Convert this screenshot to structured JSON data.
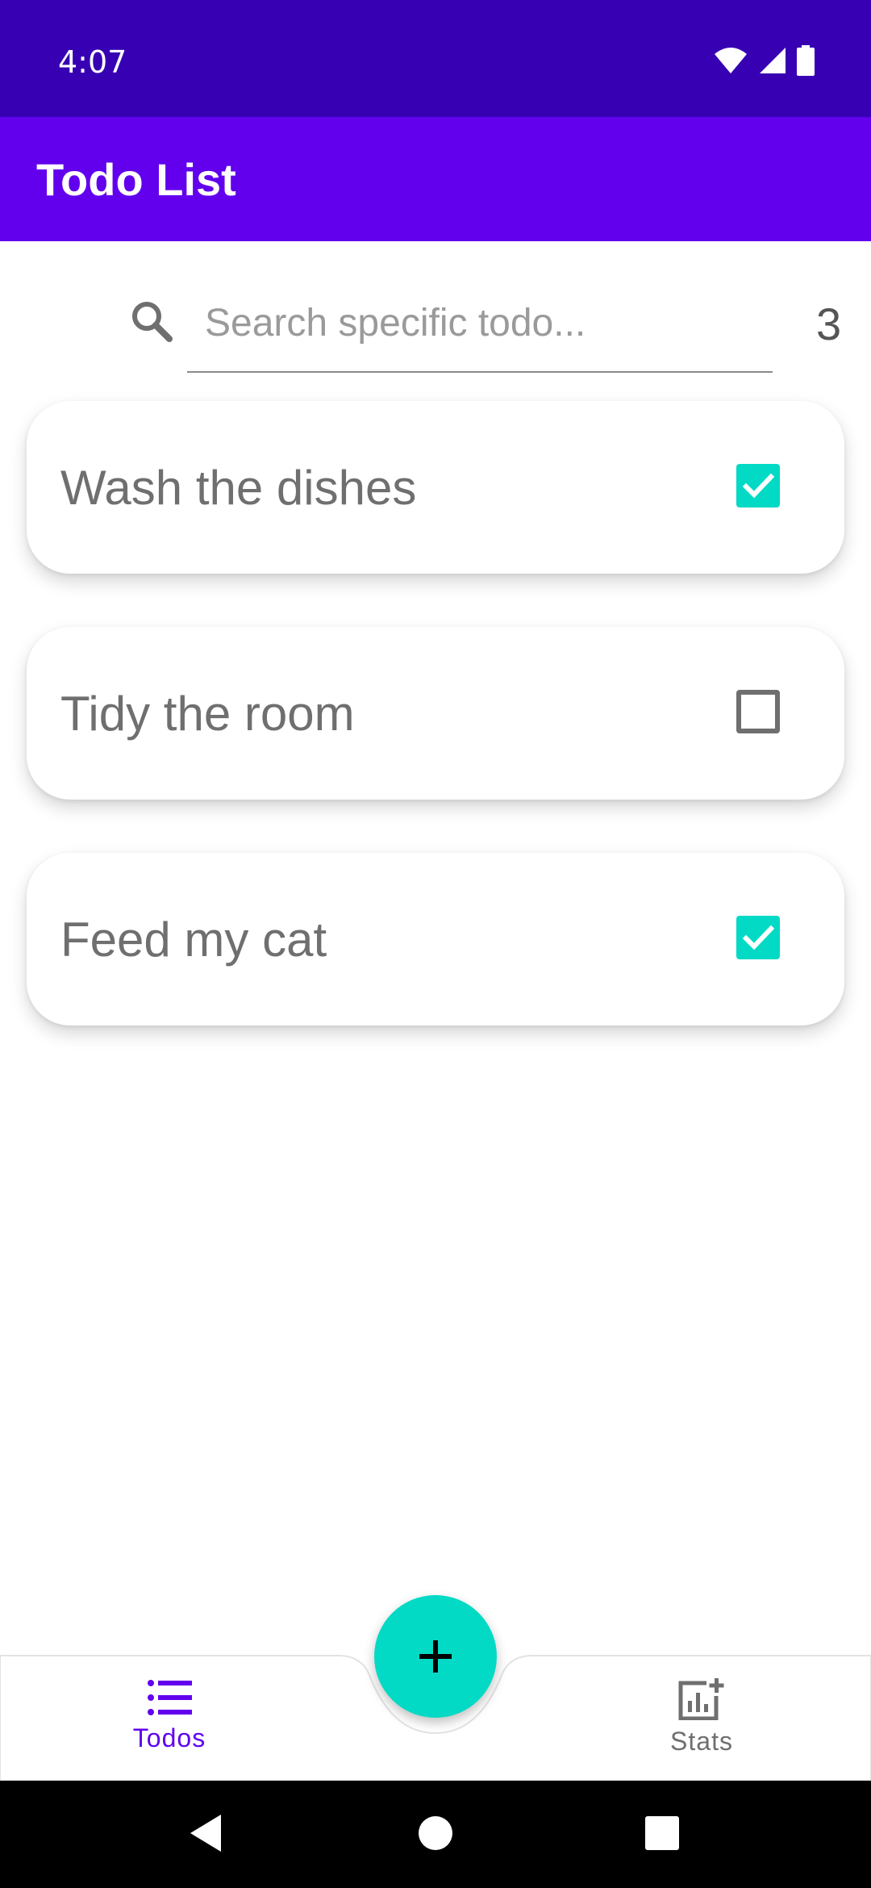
{
  "status_bar": {
    "time": "4:07",
    "icons": [
      "wifi-icon",
      "signal-icon",
      "battery-icon"
    ],
    "background": "#3700b3"
  },
  "app_bar": {
    "title": "Todo List",
    "background": "#6200ee"
  },
  "search": {
    "placeholder": "Search specific todo...",
    "value": "",
    "icon": "search-icon",
    "count": "3"
  },
  "todos": [
    {
      "text": "Wash the dishes",
      "checked": true
    },
    {
      "text": "Tidy the room",
      "checked": false
    },
    {
      "text": "Feed my cat",
      "checked": true
    }
  ],
  "bottom_nav": {
    "items": [
      {
        "label": "Todos",
        "icon": "list-icon",
        "active": true
      },
      {
        "label": "Stats",
        "icon": "stats-add-icon",
        "active": false
      }
    ],
    "fab_icon": "plus-icon"
  },
  "system_nav": {
    "buttons": [
      "back-icon",
      "home-icon",
      "recents-icon"
    ]
  },
  "colors": {
    "primary": "#6200ee",
    "primary_dark": "#3700b3",
    "secondary": "#03dac5",
    "text_gray": "#6f6f6f"
  }
}
